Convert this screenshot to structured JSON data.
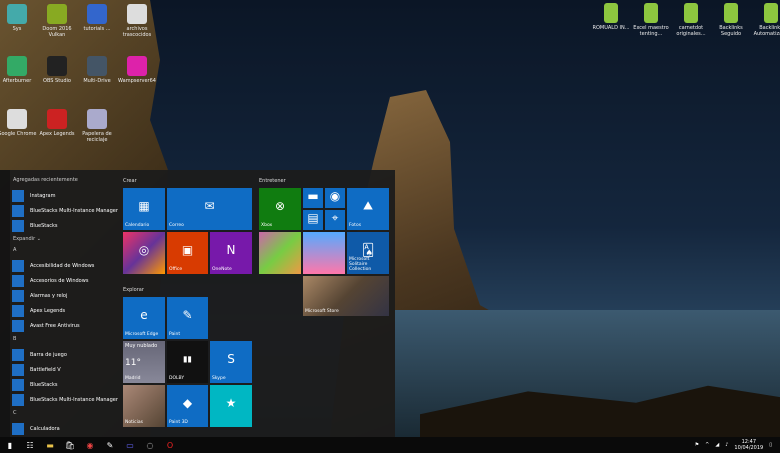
{
  "desktop": {
    "icons_left": [
      "Sys",
      "Doom 2016 Vulkan",
      "tutorials ...",
      "archivos trascocidos",
      "Afterburner",
      "OBS Studio",
      "Multi-Drive",
      "Wampserver64",
      "Google Chrome",
      "Apex Legends",
      "Papelera de reciclaje"
    ],
    "icons_right": [
      "ROMUALD IN...",
      "Excel maestro tenting...",
      "carnetdot originales...",
      "Backlinks Seguido",
      "Backlinks Automatizado"
    ]
  },
  "start": {
    "recent_header": "Agregadas recientemente",
    "recent": [
      "Instagram",
      "BlueStacks Multi-Instance Manager",
      "BlueStacks"
    ],
    "expand": "Expandir ⌄",
    "sections": [
      {
        "letter": "A",
        "apps": [
          {
            "name": "Accesibilidad de Windows",
            "expand": true
          },
          {
            "name": "Accesorios de Windows",
            "expand": true
          },
          {
            "name": "Alarmas y reloj"
          },
          {
            "name": "Apex Legends",
            "expand": true
          },
          {
            "name": "Avast Free Antivirus"
          }
        ]
      },
      {
        "letter": "B",
        "apps": [
          {
            "name": "Barra de juego"
          },
          {
            "name": "Battlefield V",
            "expand": true
          },
          {
            "name": "BlueStacks",
            "sub": "Nuevo"
          },
          {
            "name": "BlueStacks Multi-Instance Manager",
            "sub": "Nuevo"
          }
        ]
      },
      {
        "letter": "C",
        "apps": [
          {
            "name": "Calculadora"
          }
        ]
      }
    ],
    "groups": {
      "create": "Crear",
      "play": "Entretener",
      "explore": "Explorar"
    },
    "tiles": {
      "calendar": "Calendario",
      "mail": "Correo",
      "office": "Office",
      "onenote": "OneNote",
      "xbox": "Xbox",
      "photos": "Fotos",
      "solitaire": "Microsoft Solitaire Collection",
      "store": "Microsoft Store",
      "edge": "Microsoft Edge",
      "paint": "Paint",
      "weather_cond": "Muy nublado",
      "weather_temp": "11°",
      "weather_city": "Madrid",
      "dolby": "DOLBY",
      "skype": "Skype",
      "news": "Noticias",
      "paint3d": "Paint 3D"
    }
  },
  "tray": {
    "time": "12:47",
    "date": "10/04/2019"
  },
  "colors": {
    "tile_blue": "#0f6cc4",
    "office": "#d83b01",
    "onenote": "#7719aa",
    "xbox": "#107c10",
    "teal": "#00b7c3"
  }
}
